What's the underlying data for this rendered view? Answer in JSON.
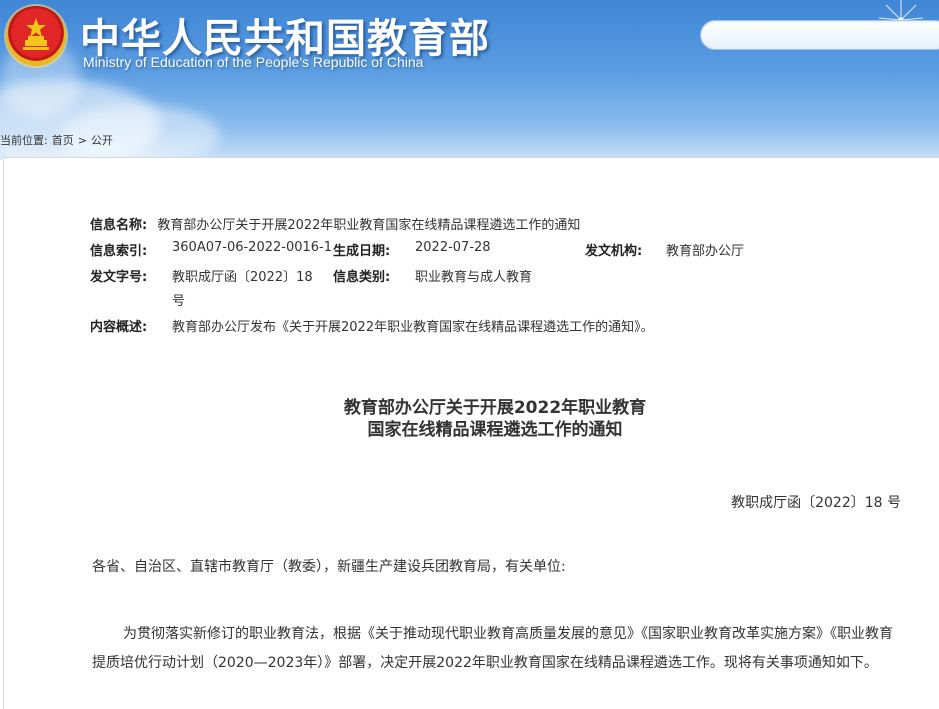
{
  "header": {
    "title": "中华人民共和国教育部",
    "subtitle": "Ministry of Education of the People's Republic of China",
    "search_placeholder": ""
  },
  "breadcrumb": {
    "prefix": "当前位置:",
    "home": "首页",
    "separator": ">",
    "current": "公开"
  },
  "meta": {
    "name_label": "信息名称:",
    "name_value": "教育部办公厅关于开展2022年职业教育国家在线精品课程遴选工作的通知",
    "index_label": "信息索引:",
    "index_value": "360A07-06-2022-0016-1",
    "date_label": "生成日期:",
    "date_value": "2022-07-28",
    "org_label": "发文机构:",
    "org_value": "教育部办公厅",
    "docno_label": "发文字号:",
    "docno_value_line1": "教职成厅函〔2022〕18",
    "docno_value_line2": "号",
    "category_label": "信息类别:",
    "category_value": "职业教育与成人教育",
    "summary_label": "内容概述:",
    "summary_value": "教育部办公厅发布《关于开展2022年职业教育国家在线精品课程遴选工作的通知》。"
  },
  "document": {
    "title_line1": "教育部办公厅关于开展2022年职业教育",
    "title_line2": "国家在线精品课程遴选工作的通知",
    "number": "教职成厅函〔2022〕18 号",
    "addressee": "各省、自治区、直辖市教育厅（教委），新疆生产建设兵团教育局，有关单位:",
    "paragraph1": "为贯彻落实新修订的职业教育法，根据《关于推动现代职业教育高质量发展的意见》《国家职业教育改革实施方案》《职业教育提质培优行动计划（2020—2023年）》部署，决定开展2022年职业教育国家在线精品课程遴选工作。现将有关事项通知如下。"
  },
  "colors": {
    "header_blue": "#3f86d6",
    "text": "#333333"
  }
}
